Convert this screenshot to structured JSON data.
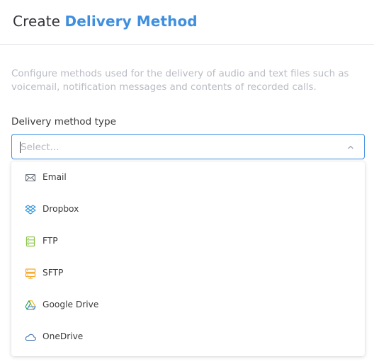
{
  "header": {
    "title_prefix": "Create",
    "title_accent": "Delivery Method"
  },
  "description": "Configure methods used for the delivery of audio and text files such as voicemail, notification messages and contents of recorded calls.",
  "field": {
    "label": "Delivery method type",
    "placeholder": "Select...",
    "value": ""
  },
  "options": [
    {
      "label": "Email",
      "icon": "envelope-icon"
    },
    {
      "label": "Dropbox",
      "icon": "dropbox-icon"
    },
    {
      "label": "FTP",
      "icon": "ftp-server-icon"
    },
    {
      "label": "SFTP",
      "icon": "sftp-server-icon"
    },
    {
      "label": "Google Drive",
      "icon": "google-drive-icon"
    },
    {
      "label": "OneDrive",
      "icon": "onedrive-icon"
    }
  ],
  "colors": {
    "accent": "#3f8fdf",
    "description_text": "#b9bcc4",
    "email_icon": "#6b6f7a",
    "dropbox_icon": "#2a93d9",
    "ftp_icon": "#8bc34a",
    "sftp_icon": "#f5a623",
    "onedrive_icon": "#3f6fb5"
  }
}
